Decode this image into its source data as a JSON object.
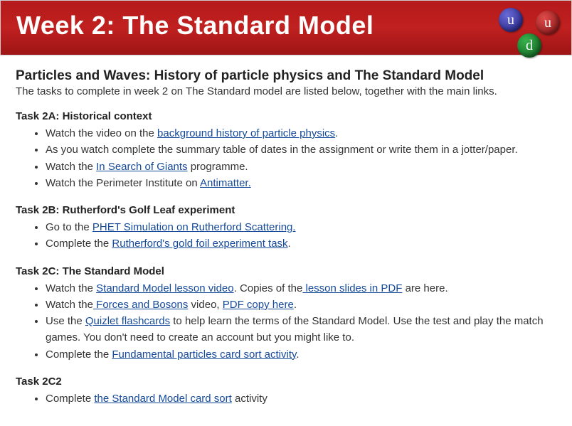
{
  "banner": {
    "title": "Week 2: The Standard Model",
    "quarks": [
      "u",
      "u",
      "d"
    ]
  },
  "subtitle": "Particles and Waves: History of particle physics and The Standard Model",
  "intro": "The tasks to complete in week 2 on The Standard model are listed below, together with the main links.",
  "tasks": [
    {
      "title": "Task 2A: Historical context",
      "items": [
        [
          {
            "t": "Watch the video on the "
          },
          {
            "t": "background history of particle physics",
            "link": true
          },
          {
            "t": "."
          }
        ],
        [
          {
            "t": "As you watch complete the summary table of dates in the assignment or write them in a jotter/paper."
          }
        ],
        [
          {
            "t": "Watch the "
          },
          {
            "t": "In Search of Giants",
            "link": true
          },
          {
            "t": " programme."
          }
        ],
        [
          {
            "t": "Watch the Perimeter Institute on "
          },
          {
            "t": "Antimatter.",
            "link": true
          }
        ]
      ]
    },
    {
      "title": "Task 2B: Rutherford's Golf Leaf experiment",
      "items": [
        [
          {
            "t": "Go to the "
          },
          {
            "t": "PHET Simulation on Rutherford Scattering.",
            "link": true
          }
        ],
        [
          {
            "t": "Complete the "
          },
          {
            "t": "Rutherford's gold foil experiment task",
            "link": true
          },
          {
            "t": "."
          }
        ]
      ]
    },
    {
      "title": "Task 2C: The Standard Model",
      "items": [
        [
          {
            "t": "Watch the "
          },
          {
            "t": "Standard Model lesson video",
            "link": true
          },
          {
            "t": ".  Copies of the"
          },
          {
            "t": " lesson slides in PDF",
            "link": true
          },
          {
            "t": " are here."
          }
        ],
        [
          {
            "t": "Watch the"
          },
          {
            "t": " Forces and Bosons",
            "link": true
          },
          {
            "t": " video, "
          },
          {
            "t": "PDF copy here",
            "link": true
          },
          {
            "t": "."
          }
        ],
        [
          {
            "t": "Use the "
          },
          {
            "t": "Quizlet flashcards",
            "link": true
          },
          {
            "t": " to help learn the terms of the Standard Model.  Use the test and play the match games.  You don't need to create an account but you might like to."
          }
        ],
        [
          {
            "t": "Complete the "
          },
          {
            "t": "Fundamental particles card sort activity",
            "link": true
          },
          {
            "t": "."
          }
        ]
      ]
    },
    {
      "title": "Task 2C2",
      "items": [
        [
          {
            "t": "Complete "
          },
          {
            "t": "the Standard Model card sort",
            "link": true
          },
          {
            "t": " activity"
          }
        ]
      ]
    }
  ]
}
